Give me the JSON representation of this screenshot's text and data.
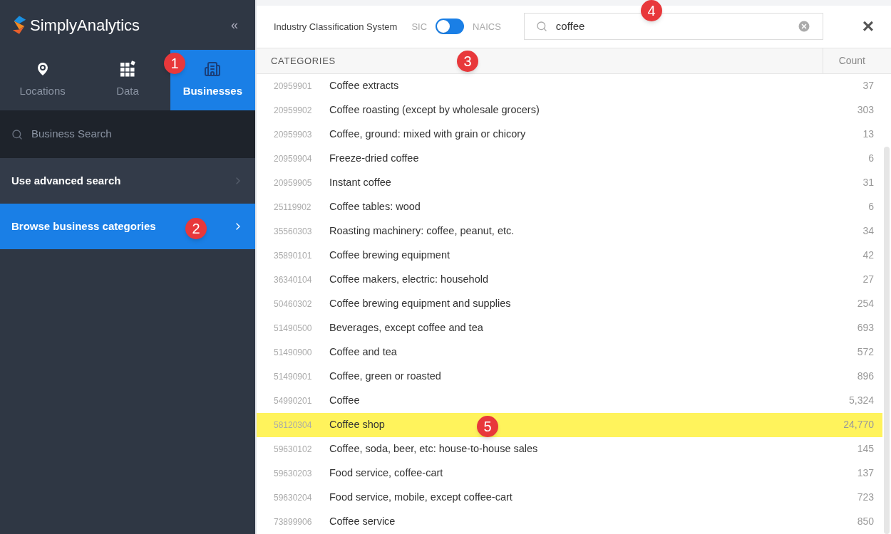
{
  "sidebar": {
    "logo": "SimplyAnalytics",
    "collapse": "«",
    "tabs": [
      {
        "label": "Locations",
        "kind": "pin",
        "selected": false
      },
      {
        "label": "Data",
        "kind": "grid",
        "selected": false
      },
      {
        "label": "Businesses",
        "kind": "building",
        "selected": true
      }
    ],
    "search": {
      "placeholder": "Business Search"
    },
    "items": [
      {
        "label": "Use advanced search",
        "selected": false
      },
      {
        "label": "Browse business categories",
        "selected": true
      }
    ]
  },
  "panel": {
    "classification": {
      "label": "Industry Classification System",
      "left": "SIC",
      "right": "NAICS",
      "on": false
    },
    "search": {
      "value": "coffee"
    },
    "close": "×",
    "columns": [
      "CATEGORIES",
      "Count"
    ],
    "rows": [
      {
        "code": "20959901",
        "name": "Coffee extracts",
        "count": "37",
        "selected": false
      },
      {
        "code": "20959902",
        "name": "Coffee roasting (except by wholesale grocers)",
        "count": "303",
        "selected": false
      },
      {
        "code": "20959903",
        "name": "Coffee, ground: mixed with grain or chicory",
        "count": "13",
        "selected": false
      },
      {
        "code": "20959904",
        "name": "Freeze-dried coffee",
        "count": "6",
        "selected": false
      },
      {
        "code": "20959905",
        "name": "Instant coffee",
        "count": "31",
        "selected": false
      },
      {
        "code": "25119902",
        "name": "Coffee tables: wood",
        "count": "6",
        "selected": false
      },
      {
        "code": "35560303",
        "name": "Roasting machinery: coffee, peanut, etc.",
        "count": "34",
        "selected": false
      },
      {
        "code": "35890101",
        "name": "Coffee brewing equipment",
        "count": "42",
        "selected": false
      },
      {
        "code": "36340104",
        "name": "Coffee makers, electric: household",
        "count": "27",
        "selected": false
      },
      {
        "code": "50460302",
        "name": "Coffee brewing equipment and supplies",
        "count": "254",
        "selected": false
      },
      {
        "code": "51490500",
        "name": "Beverages, except coffee and tea",
        "count": "693",
        "selected": false
      },
      {
        "code": "51490900",
        "name": "Coffee and tea",
        "count": "572",
        "selected": false
      },
      {
        "code": "51490901",
        "name": "Coffee, green or roasted",
        "count": "896",
        "selected": false
      },
      {
        "code": "54990201",
        "name": "Coffee",
        "count": "5,324",
        "selected": false
      },
      {
        "code": "58120304",
        "name": "Coffee shop",
        "count": "24,770",
        "selected": true
      },
      {
        "code": "59630102",
        "name": "Coffee, soda, beer, etc: house-to-house sales",
        "count": "145",
        "selected": false
      },
      {
        "code": "59630203",
        "name": "Food service, coffee-cart",
        "count": "137",
        "selected": false
      },
      {
        "code": "59630204",
        "name": "Food service, mobile, except coffee-cart",
        "count": "723",
        "selected": false
      },
      {
        "code": "73899906",
        "name": "Coffee service",
        "count": "850",
        "selected": false
      }
    ]
  },
  "callouts": [
    "1",
    "2",
    "3",
    "4",
    "5"
  ]
}
